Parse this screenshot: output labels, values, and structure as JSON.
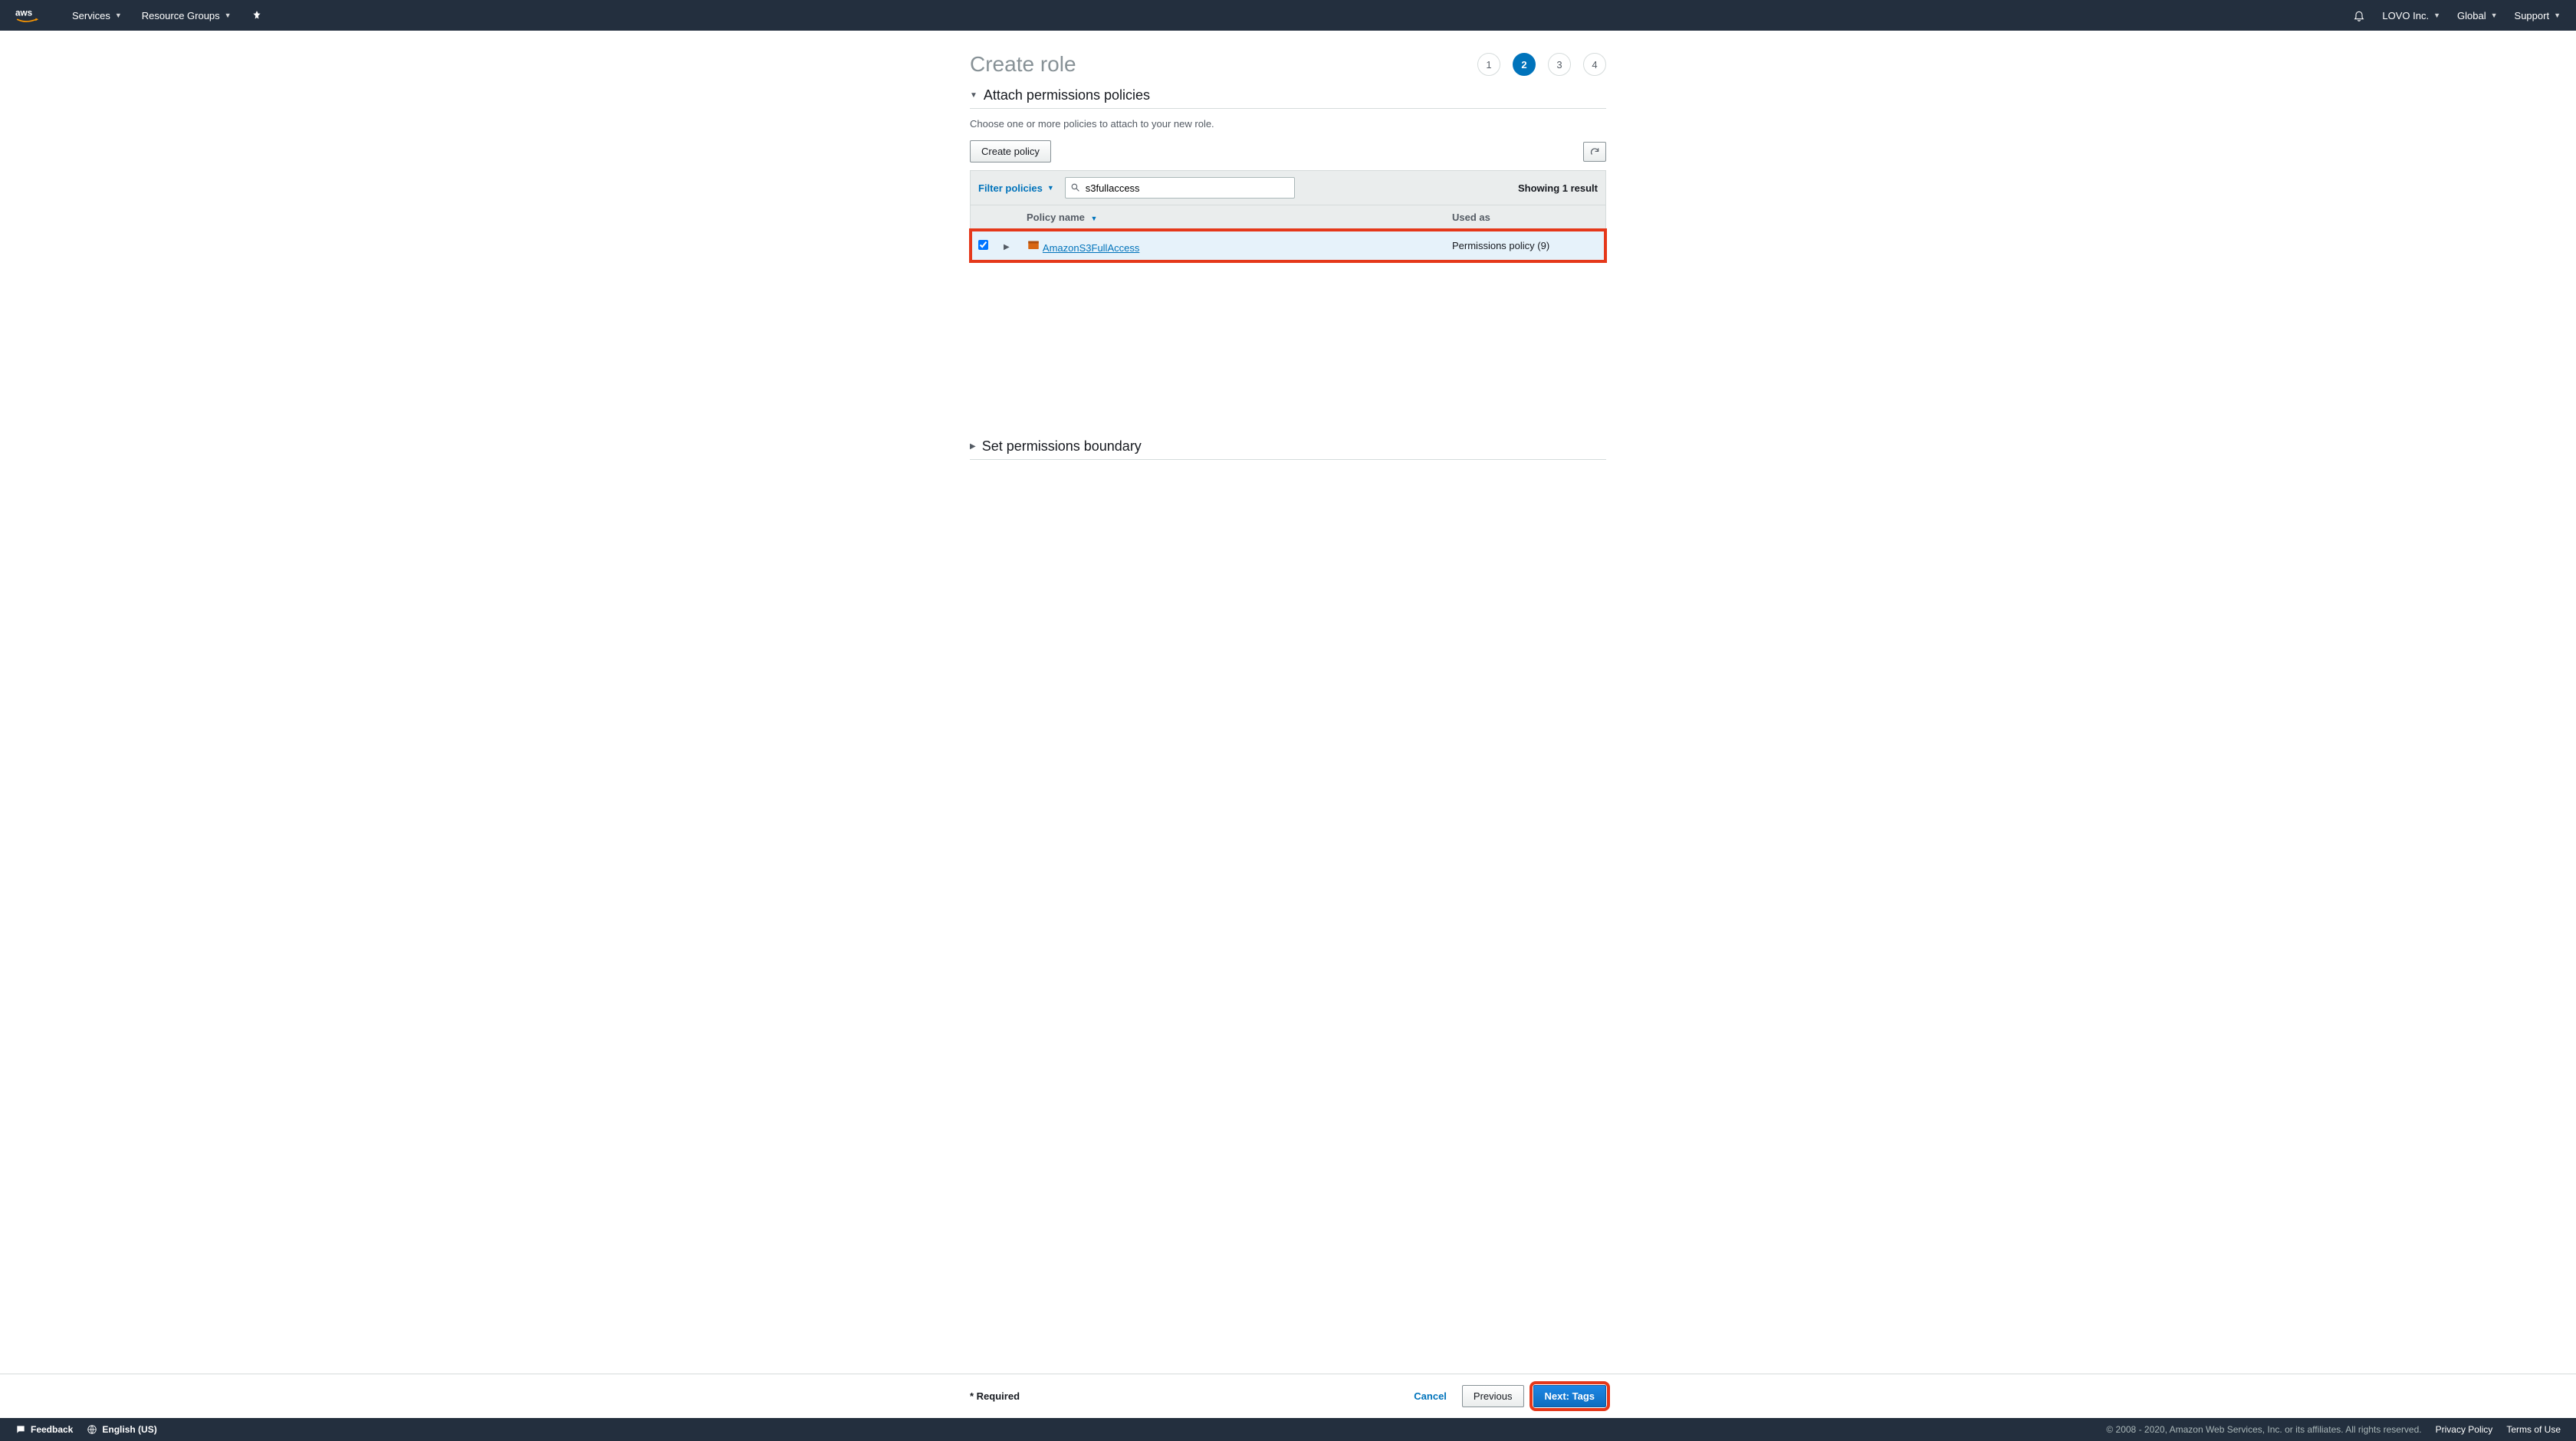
{
  "nav": {
    "services": "Services",
    "resource_groups": "Resource Groups",
    "account": "LOVO Inc.",
    "region": "Global",
    "support": "Support"
  },
  "page": {
    "title": "Create role",
    "steps": [
      "1",
      "2",
      "3",
      "4"
    ],
    "active_step_index": 1,
    "attach_heading": "Attach permissions policies",
    "attach_desc": "Choose one or more policies to attach to your new role.",
    "create_policy_btn": "Create policy",
    "filter_label": "Filter policies",
    "search_value": "s3fullaccess",
    "result_count": "Showing 1 result",
    "col_policy": "Policy name",
    "col_used": "Used as",
    "row": {
      "name": "AmazonS3FullAccess",
      "used": "Permissions policy (9)",
      "checked": true
    },
    "boundary_heading": "Set permissions boundary",
    "required": "* Required",
    "cancel": "Cancel",
    "previous": "Previous",
    "next": "Next: Tags"
  },
  "footer": {
    "feedback": "Feedback",
    "language": "English (US)",
    "copyright": "© 2008 - 2020, Amazon Web Services, Inc. or its affiliates. All rights reserved.",
    "privacy": "Privacy Policy",
    "terms": "Terms of Use"
  }
}
